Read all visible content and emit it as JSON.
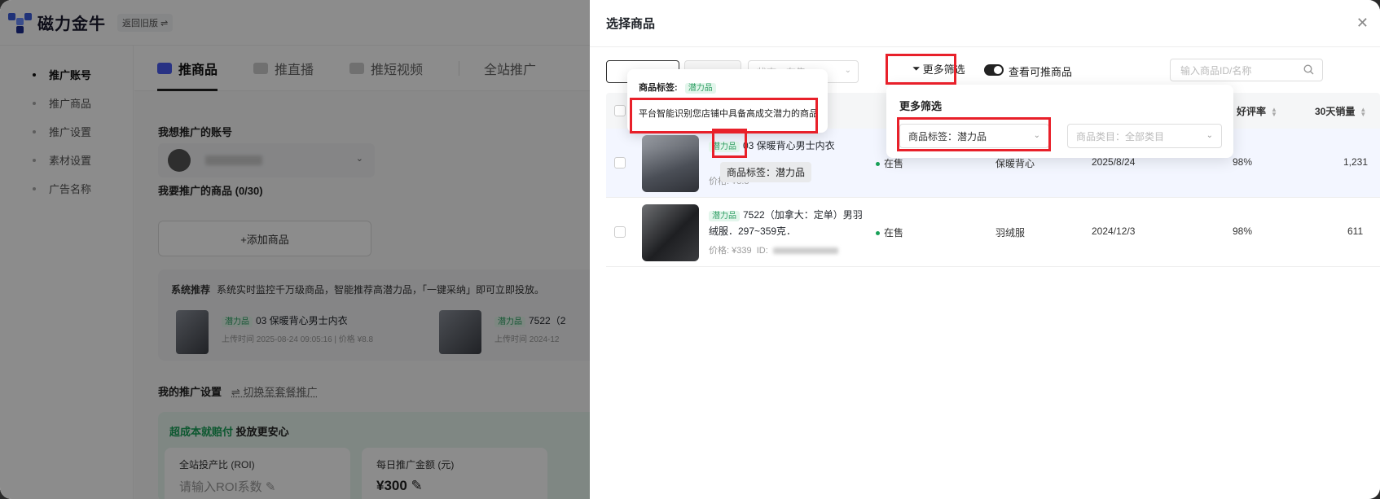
{
  "app": {
    "brand": "磁力金牛",
    "old_version": "返回旧版 ⇌"
  },
  "sidebar": {
    "items": [
      {
        "label": "推广账号",
        "active": true
      },
      {
        "label": "推广商品",
        "active": false
      },
      {
        "label": "推广设置",
        "active": false
      },
      {
        "label": "素材设置",
        "active": false
      },
      {
        "label": "广告名称",
        "active": false
      }
    ]
  },
  "main": {
    "tabs": [
      {
        "label": "推商品",
        "active": true
      },
      {
        "label": "推直播",
        "active": false
      },
      {
        "label": "推短视频",
        "active": false
      },
      {
        "label": "全站推广",
        "active": false
      }
    ],
    "account_label": "我想推广的账号",
    "products_label": "我要推广的商品 (0/30)",
    "add_product": "+添加商品",
    "rec_title": "系统推荐",
    "rec_desc": "系统实时监控千万级商品，智能推荐高潜力品，「一键采纳」即可立即投放。",
    "rec_items": [
      {
        "tag": "潜力品",
        "name": "03 保暖背心男士内衣",
        "meta": "上传时间 2025-08-24 09:05:16 | 价格 ¥8.8"
      },
      {
        "tag": "潜力品",
        "name": "7522（2",
        "meta": "上传时间 2024-12"
      }
    ],
    "settings_label": "我的推广设置",
    "switch_label": "⇌ 切换至套餐推广",
    "roi_banner": "超成本就赔付",
    "roi_banner_2": "投放更安心",
    "roi_card_1_label": "全站投产比 (ROI)",
    "roi_card_1_placeholder": "请输入ROI系数 ✎",
    "roi_card_2_label": "每日推广金额 (元)",
    "roi_card_2_value": "¥300 ✎"
  },
  "drawer": {
    "title": "选择商品",
    "close": "✕",
    "more_filter": "更多筛选",
    "toggle_label": "查看可推商品",
    "search_placeholder": "输入商品ID/名称",
    "filter_status": "状态：在售",
    "table_headers": {
      "rating": "好评率",
      "sales": "30天销量"
    },
    "rows": [
      {
        "tag": "潜力品",
        "name": "03 保暖背心男士内衣",
        "price": "价格: ¥8.8",
        "status": "在售",
        "category": "保暖背心",
        "date": "2025/8/24",
        "rating": "98%",
        "sales": "1,231"
      },
      {
        "tag": "潜力品",
        "name": "7522（加拿大：定单）男羽绒服．297~359克．",
        "price": "价格: ¥339",
        "id_label": "ID:",
        "status": "在售",
        "category": "羽绒服",
        "date": "2024/12/3",
        "rating": "98%",
        "sales": "611"
      }
    ],
    "tooltip_label": "商品标签:",
    "tooltip_tag": "潜力品",
    "tooltip_desc": "平台智能识别您店铺中具备高成交潜力的商品",
    "hover_tip": "商品标签：潜力品",
    "popover": {
      "title": "更多筛选",
      "tag_select": "商品标签：潜力品",
      "category_select": "商品类目：全部类目"
    }
  },
  "colors": {
    "accent": "#4a5cf0",
    "tag_green": "#2f9e63",
    "highlight_red": "#e8202a"
  }
}
